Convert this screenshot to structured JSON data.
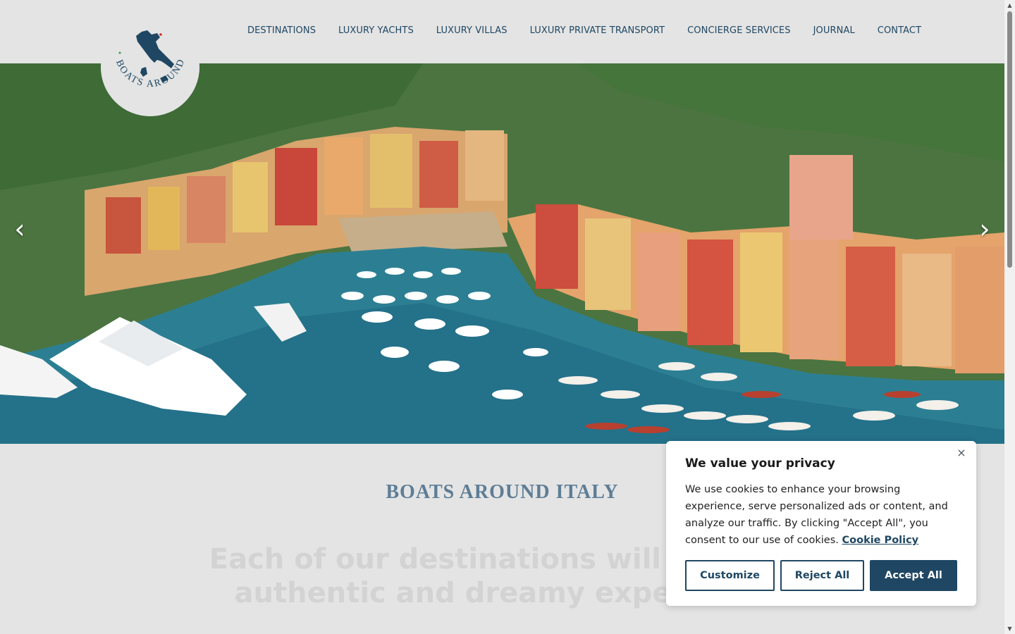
{
  "brand": {
    "logo_text": "BOATS AROUND ITALY"
  },
  "nav": {
    "items": [
      {
        "label": "DESTINATIONS"
      },
      {
        "label": "LUXURY YACHTS"
      },
      {
        "label": "LUXURY VILLAS"
      },
      {
        "label": "LUXURY PRIVATE TRANSPORT"
      },
      {
        "label": "CONCIERGE SERVICES"
      },
      {
        "label": "JOURNAL"
      },
      {
        "label": "CONTACT"
      }
    ]
  },
  "hero": {
    "prev_icon": "chevron-left-icon",
    "next_icon": "chevron-right-icon",
    "prev_glyph": "‹",
    "next_glyph": "›"
  },
  "intro": {
    "title": "BOATS AROUND ITALY",
    "headline": "Each of our destinations will offer an authentic and dreamy experience"
  },
  "cookie": {
    "title": "We value your privacy",
    "body": "We use cookies to enhance your browsing experience, serve personalized ads or content, and analyze our traffic. By clicking \"Accept All\", you consent to our use of cookies.",
    "policy_link": "Cookie Policy",
    "close_glyph": "×",
    "buttons": {
      "customize": "Customize",
      "reject": "Reject All",
      "accept": "Accept All"
    }
  },
  "colors": {
    "brand_navy": "#1f4763",
    "title_blue": "#5e7d96",
    "background": "#e4e4e4"
  }
}
